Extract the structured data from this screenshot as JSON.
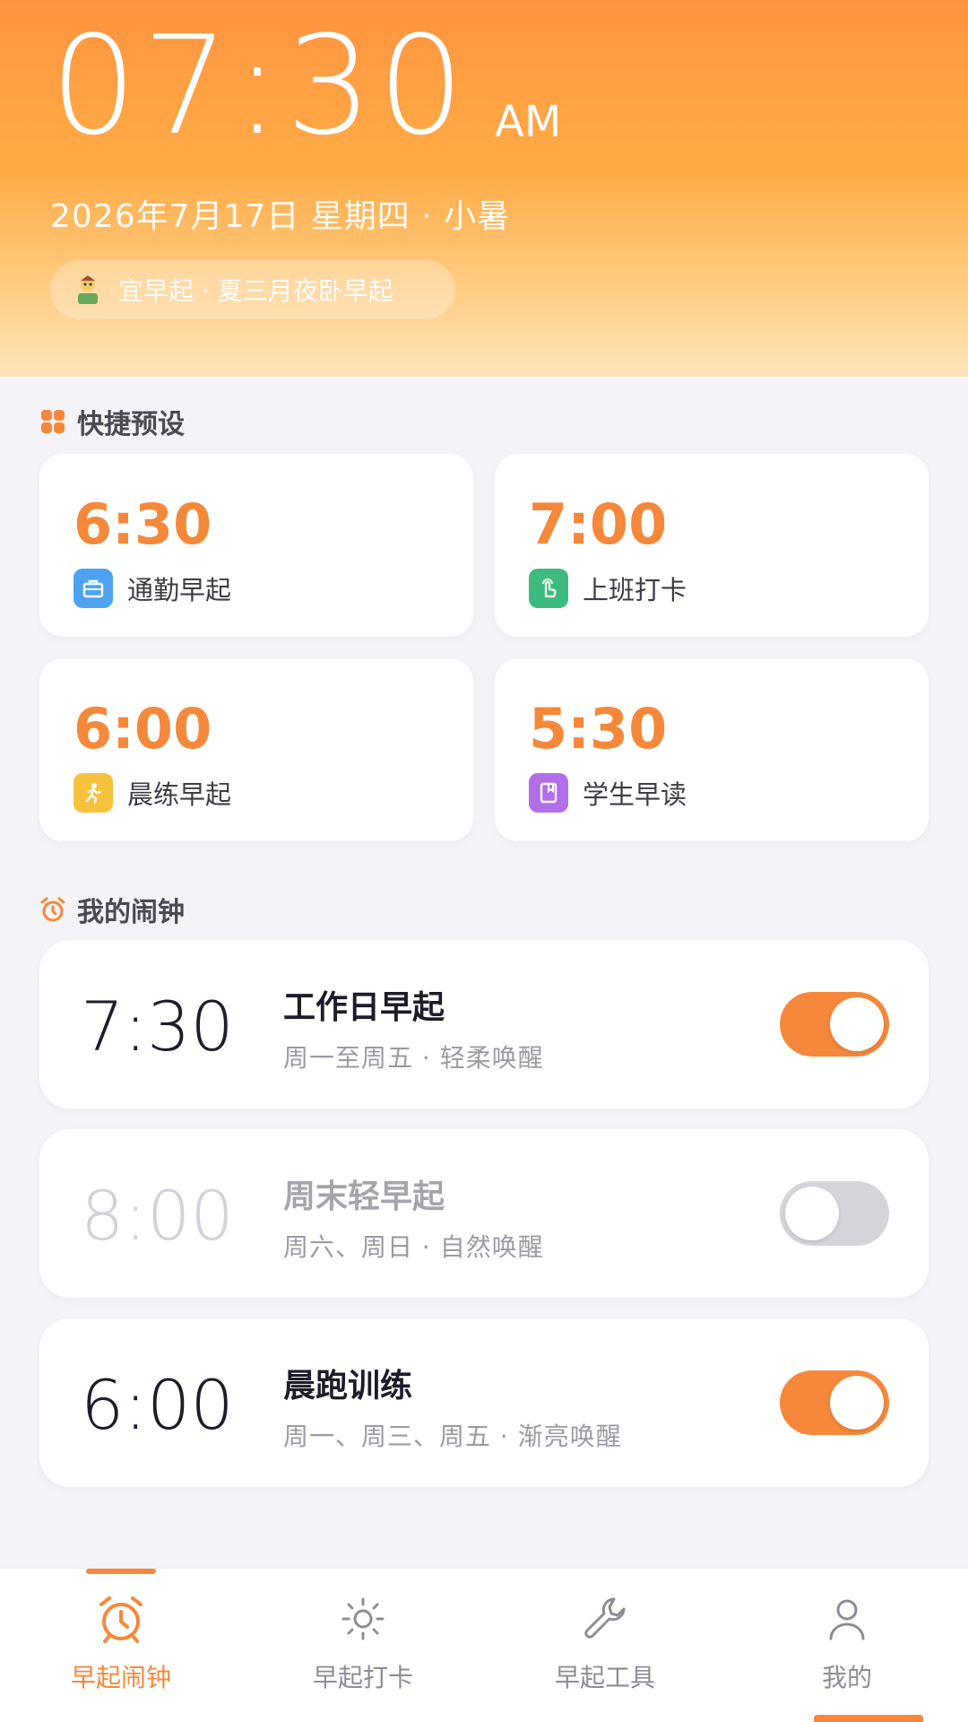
{
  "header": {
    "time": "07:30",
    "ampm": "AM",
    "date": "2026年7月17日 星期四 · 小暑",
    "tip": "宜早起 · 夏三月夜卧早起"
  },
  "presets": {
    "title": "快捷预设",
    "items": [
      {
        "time": "6:30",
        "label": "通勤早起",
        "icon": "briefcase-icon",
        "color": "#4da3f0"
      },
      {
        "time": "7:00",
        "label": "上班打卡",
        "icon": "tap-hand-icon",
        "color": "#3dbb7e"
      },
      {
        "time": "6:00",
        "label": "晨练早起",
        "icon": "runner-icon",
        "color": "#f7c23b"
      },
      {
        "time": "5:30",
        "label": "学生早读",
        "icon": "book-icon",
        "color": "#b06ee8"
      }
    ]
  },
  "alarms": {
    "title": "我的闹钟",
    "items": [
      {
        "time": "7:30",
        "name": "工作日早起",
        "sub": "周一至周五 · 轻柔唤醒",
        "enabled": true
      },
      {
        "time": "8:00",
        "name": "周末轻早起",
        "sub": "周六、周日 · 自然唤醒",
        "enabled": false
      },
      {
        "time": "6:00",
        "name": "晨跑训练",
        "sub": "周一、周三、周五 · 渐亮唤醒",
        "enabled": true
      }
    ]
  },
  "nav": {
    "items": [
      {
        "label": "早起闹钟",
        "icon": "alarm-clock-icon",
        "active": true
      },
      {
        "label": "早起打卡",
        "icon": "sun-icon",
        "active": false
      },
      {
        "label": "早起工具",
        "icon": "wrench-icon",
        "active": false
      },
      {
        "label": "我的",
        "icon": "user-icon",
        "active": false
      }
    ]
  },
  "colors": {
    "accent": "#f5883a",
    "header_top": "#ff9440",
    "header_bottom": "#ffe6bc"
  }
}
